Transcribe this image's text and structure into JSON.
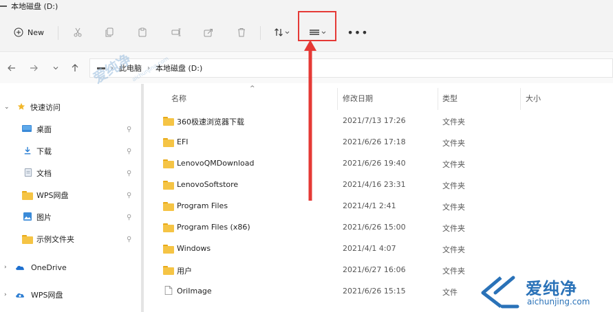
{
  "window": {
    "title": "本地磁盘 (D:)"
  },
  "toolbar": {
    "new_label": "New",
    "more_label": "•••",
    "icons": [
      "cut-icon",
      "copy-icon",
      "paste-icon",
      "rename-icon",
      "share-icon",
      "delete-icon",
      "sort-icon",
      "view-icon",
      "more-icon"
    ]
  },
  "address": {
    "crumbs": [
      "此电脑",
      "本地磁盘 (D:)"
    ]
  },
  "sidebar": {
    "items": [
      {
        "label": "快速访问",
        "icon": "star-icon",
        "expandable": true,
        "pinned": false
      },
      {
        "label": "桌面",
        "icon": "desktop-icon",
        "expandable": false,
        "pinned": true
      },
      {
        "label": "下载",
        "icon": "download-icon",
        "expandable": false,
        "pinned": true
      },
      {
        "label": "文档",
        "icon": "document-icon",
        "expandable": false,
        "pinned": true
      },
      {
        "label": "WPS网盘",
        "icon": "folder-icon",
        "expandable": false,
        "pinned": true
      },
      {
        "label": "图片",
        "icon": "picture-icon",
        "expandable": false,
        "pinned": true
      },
      {
        "label": "示例文件夹",
        "icon": "folder-icon",
        "expandable": false,
        "pinned": true
      },
      {
        "label": "OneDrive",
        "icon": "cloud-icon",
        "expandable": true,
        "pinned": false
      },
      {
        "label": "WPS网盘",
        "icon": "cloud-icon",
        "expandable": true,
        "pinned": false
      }
    ]
  },
  "columns": {
    "name": "名称",
    "modified": "修改日期",
    "type": "类型",
    "size": "大小"
  },
  "files": [
    {
      "name": "360极速浏览器下载",
      "modified": "2021/7/13 17:26",
      "type": "文件夹",
      "kind": "folder"
    },
    {
      "name": "EFI",
      "modified": "2021/6/26 17:18",
      "type": "文件夹",
      "kind": "folder"
    },
    {
      "name": "LenovoQMDownload",
      "modified": "2021/6/26 19:40",
      "type": "文件夹",
      "kind": "folder"
    },
    {
      "name": "LenovoSoftstore",
      "modified": "2021/4/16 23:31",
      "type": "文件夹",
      "kind": "folder"
    },
    {
      "name": "Program Files",
      "modified": "2021/4/1 2:41",
      "type": "文件夹",
      "kind": "folder"
    },
    {
      "name": "Program Files (x86)",
      "modified": "2021/6/26 15:00",
      "type": "文件夹",
      "kind": "folder"
    },
    {
      "name": "Windows",
      "modified": "2021/4/1 4:07",
      "type": "文件夹",
      "kind": "folder"
    },
    {
      "name": "用户",
      "modified": "2021/6/27 16:06",
      "type": "文件夹",
      "kind": "folder"
    },
    {
      "name": "OriImage",
      "modified": "2021/6/26 15:15",
      "type": "文件",
      "kind": "file"
    }
  ],
  "watermark": {
    "brand": "爱纯净",
    "url": "aichunjing.com"
  },
  "colors": {
    "highlight": "#e53935",
    "folder": "#f5c445",
    "brand": "#2a72b8"
  }
}
